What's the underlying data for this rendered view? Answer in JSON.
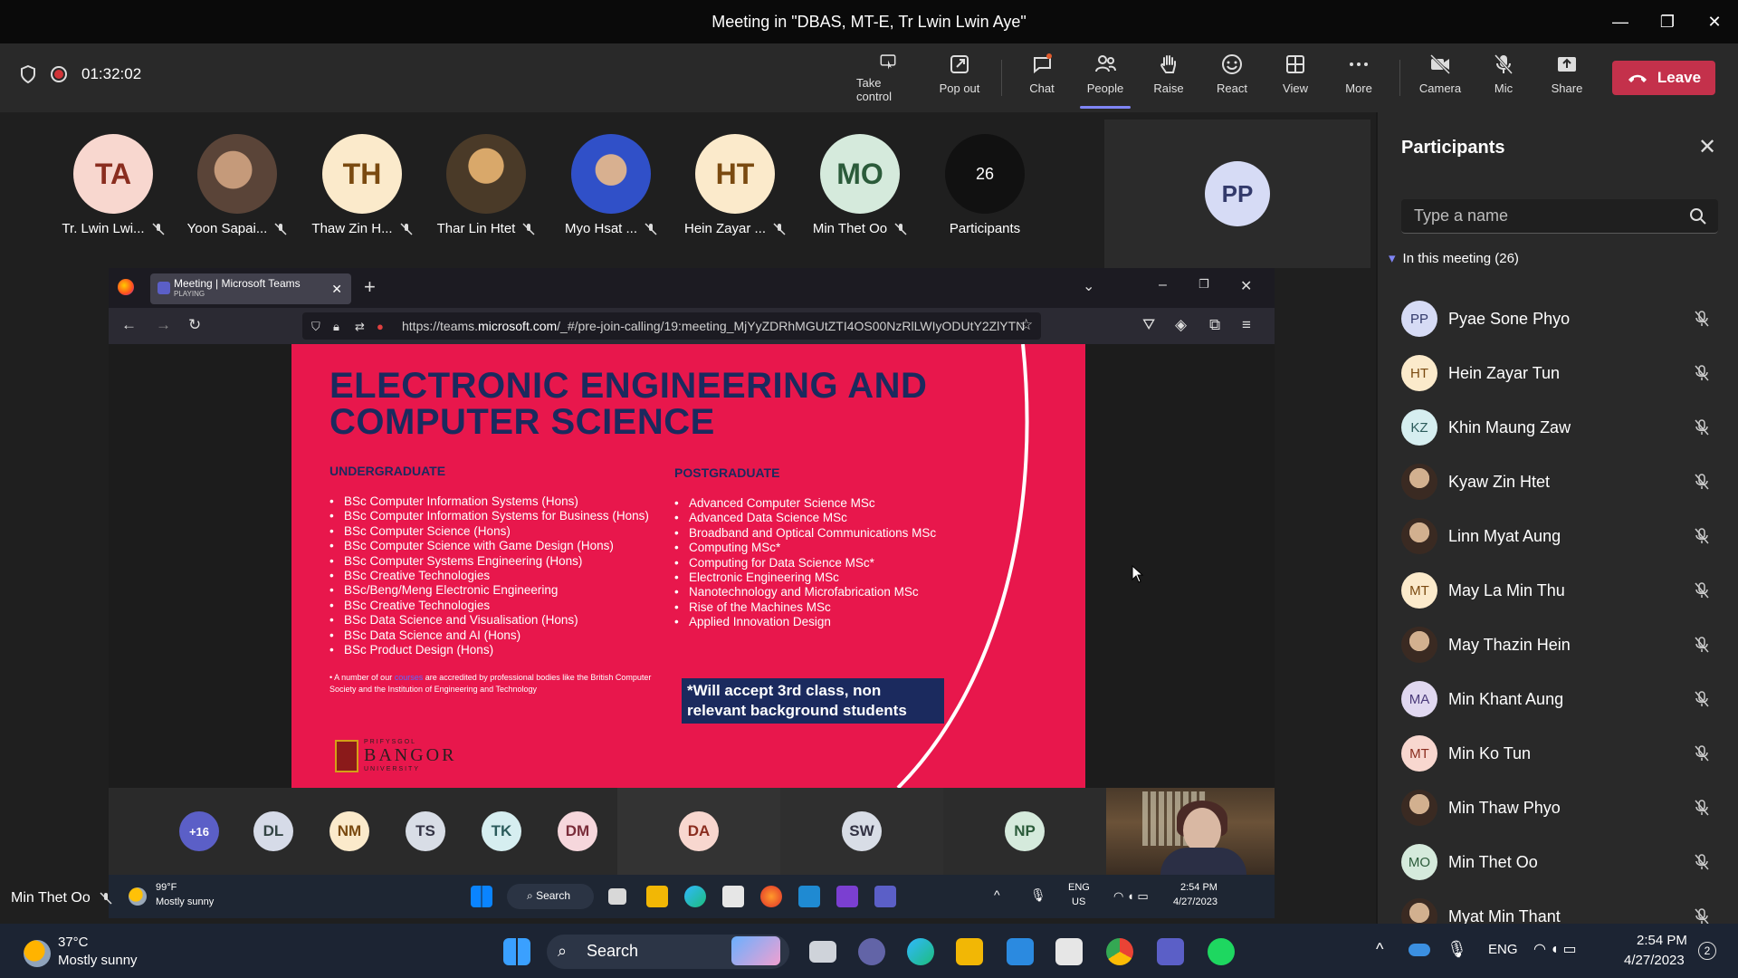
{
  "window": {
    "title": "Meeting in \"DBAS, MT-E, Tr Lwin Lwin Aye\"",
    "minimize": "—",
    "restore": "❐",
    "close": "✕"
  },
  "toolbar": {
    "timer": "01:32:02",
    "buttons": [
      {
        "label": "Take control",
        "icon": "take-control-icon"
      },
      {
        "label": "Pop out",
        "icon": "pop-out-icon"
      },
      {
        "label": "Chat",
        "icon": "chat-icon"
      },
      {
        "label": "People",
        "icon": "people-icon",
        "active": true
      },
      {
        "label": "Raise",
        "icon": "raise-hand-icon"
      },
      {
        "label": "React",
        "icon": "react-icon"
      },
      {
        "label": "View",
        "icon": "view-icon"
      },
      {
        "label": "More",
        "icon": "more-icon"
      },
      {
        "label": "Camera",
        "icon": "camera-off-icon"
      },
      {
        "label": "Mic",
        "icon": "mic-off-icon"
      },
      {
        "label": "Share",
        "icon": "share-icon"
      }
    ],
    "leave_label": "Leave",
    "leave_color": "#c4314b"
  },
  "strip": {
    "people": [
      {
        "initials": "TA",
        "name": "Tr. Lwin Lwi...",
        "bg": "#f8d7cf",
        "fg": "#8a2d1f"
      },
      {
        "initials": "",
        "name": "Yoon Sapai...",
        "bg": "#8b6b58",
        "fg": "#fff",
        "photo": true
      },
      {
        "initials": "TH",
        "name": "Thaw Zin H...",
        "bg": "#fbeacb",
        "fg": "#7a4a10"
      },
      {
        "initials": "",
        "name": "Thar Lin Htet",
        "bg": "#6b5a40",
        "fg": "#fff",
        "photo": true
      },
      {
        "initials": "",
        "name": "Myo Hsat ...",
        "bg": "#4a6ad0",
        "fg": "#fff",
        "photo": true
      },
      {
        "initials": "HT",
        "name": "Hein Zayar ...",
        "bg": "#fbeacb",
        "fg": "#7a4a10"
      },
      {
        "initials": "MO",
        "name": "Min Thet Oo",
        "bg": "#d5eadc",
        "fg": "#2b5b3a"
      }
    ],
    "participants_count": "26",
    "participants_label": "Participants",
    "pp_initials": "PP"
  },
  "browser": {
    "tab_title": "Meeting | Microsoft Teams",
    "tab_sub": "PLAYING",
    "url_prefix": "https://teams.",
    "url_domain": "microsoft.com",
    "url_rest": "/_#/pre-join-calling/19:meeting_MjYyZDRhMGUtZTI4OS00NzRlLWIyODUtY2ZlYTN"
  },
  "slide": {
    "title": "ELECTRONIC ENGINEERING AND COMPUTER SCIENCE",
    "ug_head": "UNDERGRADUATE",
    "pg_head": "POSTGRADUATE",
    "ug_items": [
      "BSc Computer Information Systems (Hons)",
      "BSc Computer Information Systems for Business (Hons)",
      "BSc Computer Science (Hons)",
      "BSc Computer Science with Game Design (Hons)",
      "BSc Computer Systems Engineering (Hons)",
      "BSc Creative Technologies",
      "BSc/Beng/Meng  Electronic Engineering",
      "BSc Creative Technologies",
      "BSc Data Science and Visualisation (Hons)",
      "BSc Data Science and AI (Hons)",
      "BSc Product Design (Hons)"
    ],
    "pg_items": [
      "Advanced Computer Science MSc",
      "Advanced Data Science MSc",
      "Broadband and Optical Communications MSc",
      "Computing MSc*",
      "Computing for Data Science MSc*",
      "Electronic Engineering MSc",
      "Nanotechnology and Microfabrication MSc",
      "Rise of the Machines MSc",
      "Applied Innovation Design"
    ],
    "footnote_a": "A number of our ",
    "footnote_link": "courses",
    "footnote_b": " are accredited by professional bodies like the British Computer Society and the Institution of Engineering and Technology",
    "accept_text": "*Will accept 3rd class, non relevant background students",
    "logo_small": "PRIFYSGOL",
    "logo_name": "BANGOR",
    "logo_sub": "UNIVERSITY",
    "bg_color": "#e8174c",
    "title_color": "#1b2a5e"
  },
  "gallery": {
    "overflow": "+16",
    "people": [
      {
        "initials": "DL",
        "bg": "#d6dbe8",
        "fg": "#344"
      },
      {
        "initials": "NM",
        "bg": "#fbeacb",
        "fg": "#7a4a10"
      },
      {
        "initials": "TS",
        "bg": "#d8dde6",
        "fg": "#334"
      },
      {
        "initials": "TK",
        "bg": "#d6eef0",
        "fg": "#2b5b5b"
      },
      {
        "initials": "DM",
        "bg": "#f6d7dc",
        "fg": "#7a2d3a"
      },
      {
        "initials": "DA",
        "bg": "#f8d7cf",
        "fg": "#8a2d1f"
      },
      {
        "initials": "SW",
        "bg": "#d8dde6",
        "fg": "#334"
      },
      {
        "initials": "NP",
        "bg": "#d5eadc",
        "fg": "#2b5b3a"
      }
    ]
  },
  "inner_taskbar": {
    "temp": "99°F",
    "weather": "Mostly sunny",
    "search": "Search",
    "lang1": "ENG",
    "lang2": "US",
    "time": "2:54 PM",
    "date": "4/27/2023"
  },
  "presenter": "Min Thet Oo",
  "panel": {
    "title": "Participants",
    "search_placeholder": "Type a name",
    "section": "In this meeting (26)",
    "people": [
      {
        "initials": "PP",
        "name": "Pyae Sone Phyo",
        "bg": "#d6dbf5",
        "fg": "#333a6b"
      },
      {
        "initials": "HT",
        "name": "Hein Zayar Tun",
        "bg": "#fbeacb",
        "fg": "#7a4a10"
      },
      {
        "initials": "KZ",
        "name": "Khin Maung Zaw",
        "bg": "#d6eef0",
        "fg": "#2b5b5b"
      },
      {
        "initials": "",
        "name": "Kyaw Zin Htet",
        "bg": "#6b4a3a",
        "fg": "#fff",
        "photo": true
      },
      {
        "initials": "",
        "name": "Linn Myat Aung",
        "bg": "#3a4a3a",
        "fg": "#fff",
        "photo": true
      },
      {
        "initials": "MT",
        "name": "May La Min Thu",
        "bg": "#fbeacb",
        "fg": "#7a4a10"
      },
      {
        "initials": "",
        "name": "May Thazin Hein",
        "bg": "#a89070",
        "fg": "#fff",
        "photo": true
      },
      {
        "initials": "MA",
        "name": "Min Khant Aung",
        "bg": "#e0d8f0",
        "fg": "#4a3a7a"
      },
      {
        "initials": "MT",
        "name": "Min Ko Tun",
        "bg": "#f8d7cf",
        "fg": "#8a2d1f"
      },
      {
        "initials": "",
        "name": "Min Thaw Phyo",
        "bg": "#c8c8d0",
        "fg": "#fff",
        "photo": true
      },
      {
        "initials": "MO",
        "name": "Min Thet Oo",
        "bg": "#d5eadc",
        "fg": "#2b5b3a"
      },
      {
        "initials": "",
        "name": "Myat Min Thant",
        "bg": "#e0e0e0",
        "fg": "#fff",
        "photo": true
      }
    ]
  },
  "win_taskbar": {
    "temp": "37°C",
    "weather": "Mostly sunny",
    "search": "Search",
    "lang": "ENG",
    "time": "2:54 PM",
    "date": "4/27/2023",
    "notif": "2"
  }
}
